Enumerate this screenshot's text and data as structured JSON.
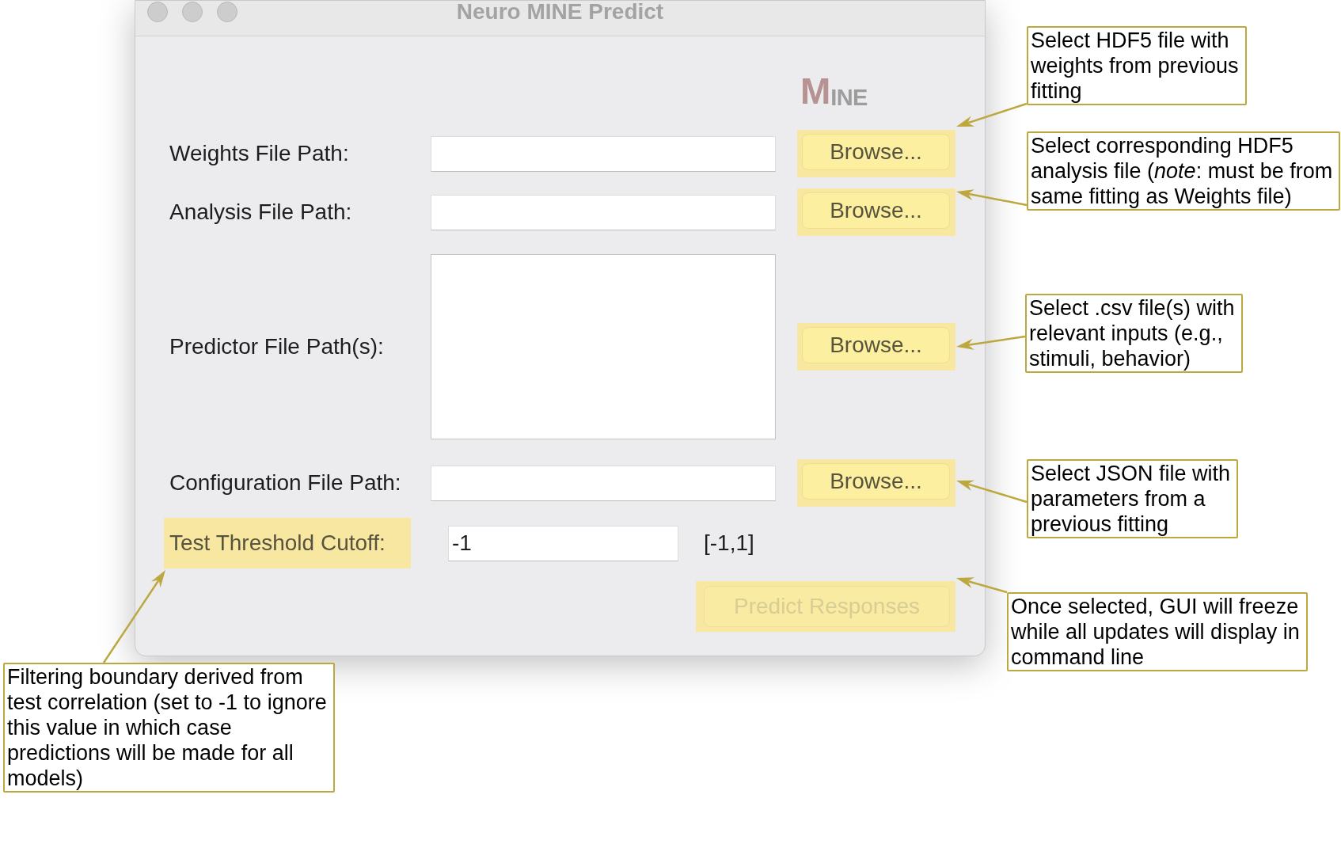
{
  "window": {
    "title": "Neuro MINE Predict"
  },
  "logo": {
    "text": "MINE"
  },
  "fields": [
    {
      "kind": "line",
      "label": "Weights File Path:",
      "button": {
        "label": "Browse...",
        "highlighted": true
      }
    },
    {
      "kind": "line",
      "label": "Analysis File Path:",
      "button": {
        "label": "Browse...",
        "highlighted": true
      }
    },
    {
      "kind": "list",
      "label": "Predictor File Path(s):",
      "button": {
        "label": "Browse...",
        "highlighted": true
      }
    },
    {
      "kind": "line",
      "label": "Configuration File Path:",
      "button": {
        "label": "Browse...",
        "highlighted": true
      }
    }
  ],
  "threshold": {
    "label": "Test Threshold Cutoff:",
    "highlighted": true,
    "value": "-1",
    "range": "[-1,1]"
  },
  "predict_button": {
    "label": "Predict Responses",
    "disabled": true,
    "highlighted": true
  },
  "annotations": [
    {
      "text": "Select HDF5 file with\nweights from previous\nfitting"
    },
    {
      "text": "Select corresponding HDF5\nanalysis file (*note*: must be from\nsame fitting as Weights file)"
    },
    {
      "text": "Select .csv file(s) with\nrelevant inputs (e.g.,\nstimuli, behavior)"
    },
    {
      "text": "Select JSON file with\nparameters from a\nprevious fitting"
    },
    {
      "text": "Once selected, GUI will freeze\nwhile all updates will display in\ncommand line"
    },
    {
      "text": "Filtering boundary derived from\ntest correlation (set to -1 to ignore\nthis value in which case\npredictions will be made for all\nmodels)"
    }
  ]
}
